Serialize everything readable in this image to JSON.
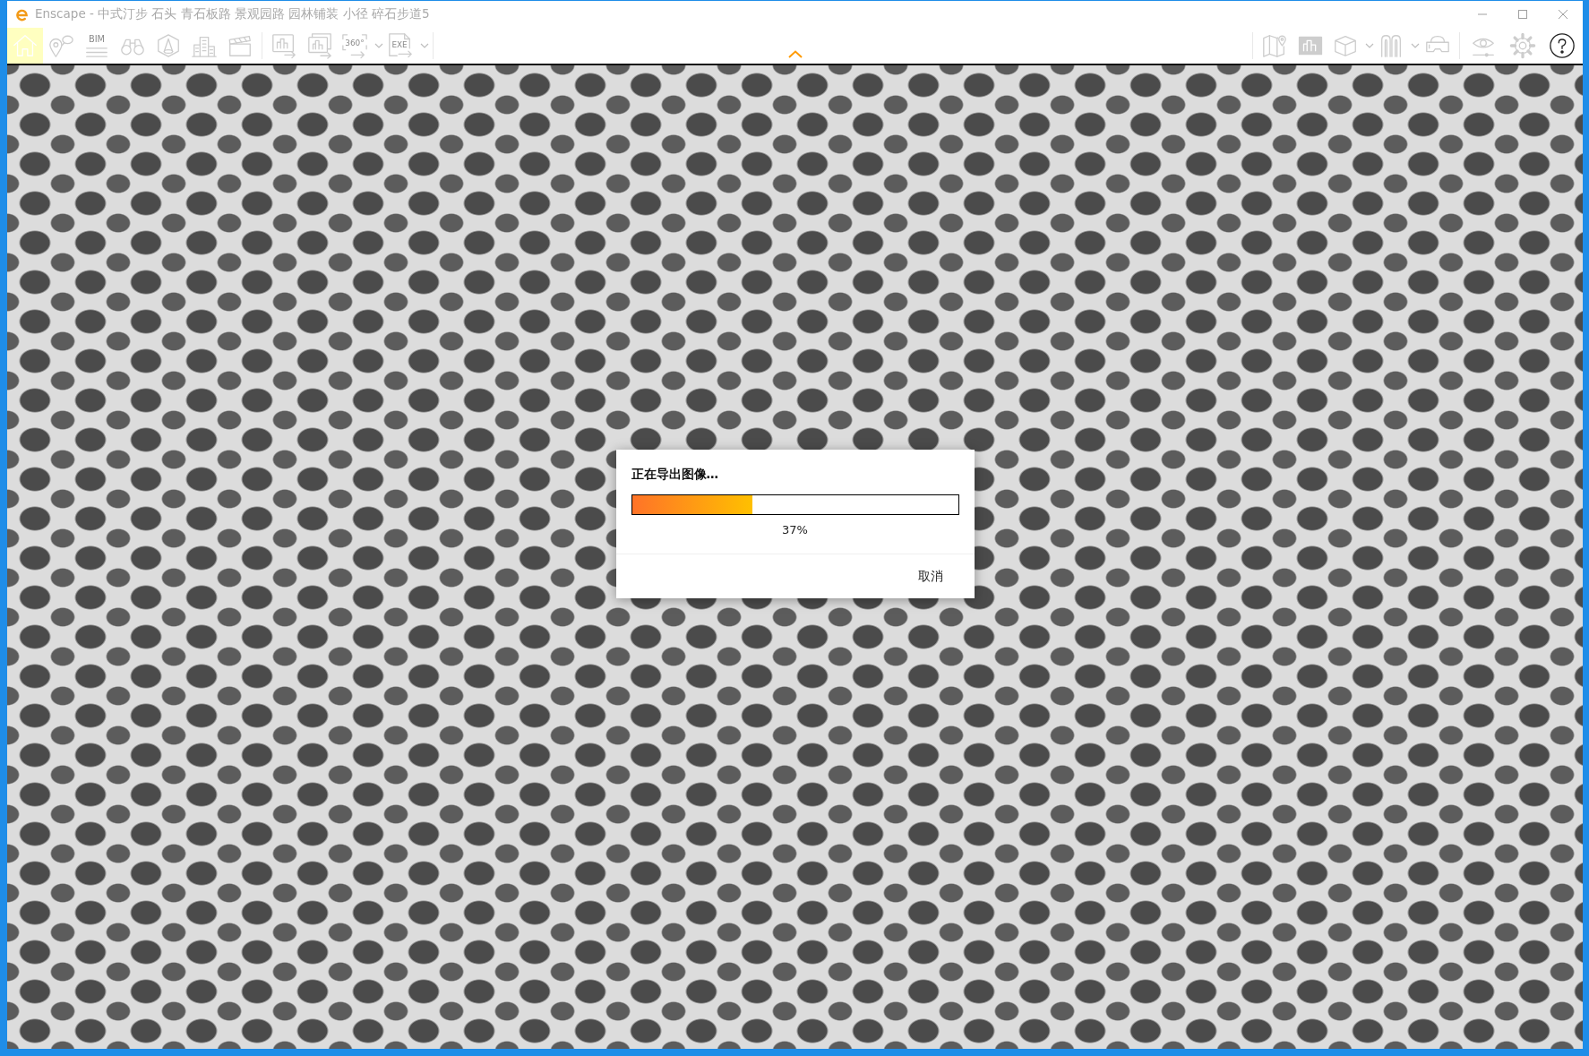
{
  "window": {
    "title": "Enscape - 中式汀步 石头 青石板路 景观园路 园林铺装 小径 碎石步道5"
  },
  "toolbar": {
    "left": [
      {
        "items": [
          {
            "kind": "home",
            "selected": true,
            "disabled": false,
            "dropdown": false
          },
          {
            "kind": "views",
            "selected": false,
            "disabled": true,
            "dropdown": false
          },
          {
            "kind": "bim",
            "label": "BIM",
            "selected": false,
            "disabled": true,
            "dropdown": false
          },
          {
            "kind": "binoculars",
            "selected": false,
            "disabled": true,
            "dropdown": false
          },
          {
            "kind": "assets",
            "selected": false,
            "disabled": true,
            "dropdown": false
          },
          {
            "kind": "buildings",
            "selected": false,
            "disabled": true,
            "dropdown": false
          },
          {
            "kind": "video",
            "selected": false,
            "disabled": true,
            "dropdown": false
          }
        ]
      },
      {
        "items": [
          {
            "kind": "screenshot",
            "selected": false,
            "disabled": true,
            "dropdown": false
          },
          {
            "kind": "batch",
            "selected": false,
            "disabled": true,
            "dropdown": false
          },
          {
            "kind": "panorama",
            "label": "360°",
            "selected": false,
            "disabled": true,
            "dropdown": true
          },
          {
            "kind": "executable",
            "label": "EXE",
            "selected": false,
            "disabled": true,
            "dropdown": true
          }
        ]
      }
    ],
    "right": [
      {
        "items": [
          {
            "kind": "map",
            "selected": false,
            "disabled": true,
            "dropdown": false
          },
          {
            "kind": "image",
            "selected": false,
            "disabled": true,
            "dropdown": false
          },
          {
            "kind": "cube",
            "selected": false,
            "disabled": true,
            "dropdown": true
          },
          {
            "kind": "arches",
            "selected": false,
            "disabled": true,
            "dropdown": true
          },
          {
            "kind": "vr",
            "selected": false,
            "disabled": true,
            "dropdown": false
          }
        ]
      },
      {
        "items": [
          {
            "kind": "eye",
            "selected": false,
            "disabled": true,
            "dropdown": false
          },
          {
            "kind": "settings",
            "selected": false,
            "disabled": true,
            "dropdown": false
          },
          {
            "kind": "help",
            "selected": false,
            "disabled": false,
            "dropdown": false
          }
        ]
      }
    ]
  },
  "dialog": {
    "title": "正在导出图像…",
    "progress": {
      "level": 0.37,
      "reading": "37%"
    },
    "cancel_button": "取消"
  }
}
